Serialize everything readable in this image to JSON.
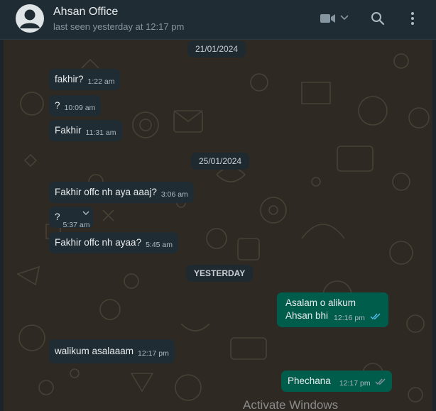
{
  "header": {
    "contact_name": "Ahsan Office",
    "last_seen": "last seen yesterday at 12:17 pm"
  },
  "icons": {
    "avatar": "default-user-avatar",
    "video": "video-call-icon",
    "dropdown": "chevron-down-icon",
    "search": "search-icon",
    "menu": "more-options-icon"
  },
  "colors": {
    "header_bg": "#202c33",
    "incoming_bubble": "#202c33",
    "outgoing_bubble": "#005c4b",
    "read_ticks": "#53bdeb"
  },
  "chat": {
    "dates": [
      "21/01/2024",
      "25/01/2024",
      "YESTERDAY"
    ],
    "messages": [
      {
        "text": "fakhir?",
        "time": "1:22 am"
      },
      {
        "text": "?",
        "time": "10:09 am"
      },
      {
        "text": "Fakhir",
        "time": "11:31 am"
      },
      {
        "text": "Fakhir offc nh aya aaaj?",
        "time": "3:06 am"
      },
      {
        "text": "?",
        "time": "5:37 am"
      },
      {
        "text": "Fakhir offc nh ayaa?",
        "time": "5:45 am"
      },
      {
        "line1": "Asalam o alikum",
        "line2": "Ahsan bhi",
        "time": "12:16 pm"
      },
      {
        "text": "walikum asalaaam",
        "time": "12:17 pm"
      },
      {
        "text": "Phechana",
        "time": "12:17 pm"
      }
    ]
  },
  "watermark": "Activate Windows"
}
